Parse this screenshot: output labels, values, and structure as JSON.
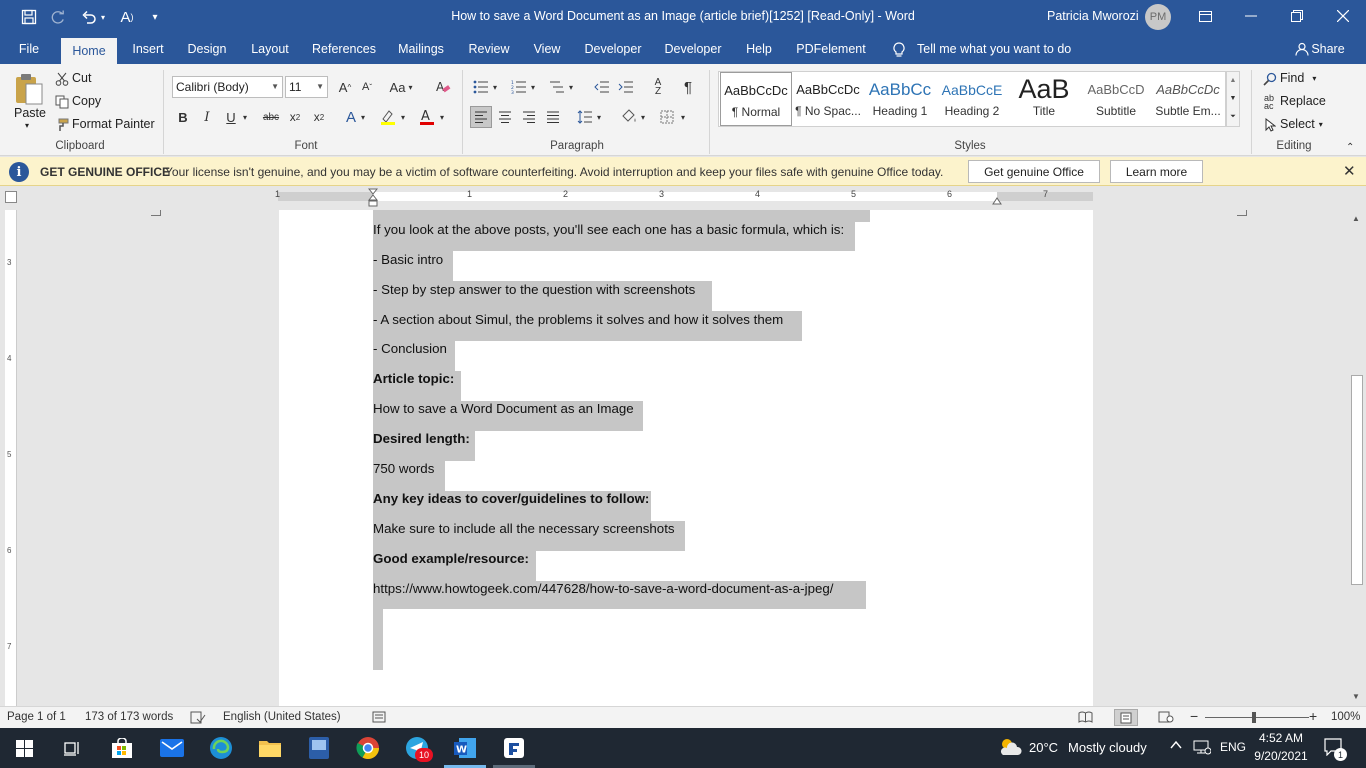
{
  "window": {
    "title": "How to save a Word Document as an Image (article brief)[1252] [Read-Only]  -  Word",
    "user_name": "Patricia Mworozi",
    "avatar_initials": "PM",
    "quick_access": [
      "save-icon",
      "redo-icon",
      "undo-icon",
      "read-aloud-icon",
      "customize-qat-icon"
    ]
  },
  "menu": {
    "tabs": [
      "File",
      "Home",
      "Insert",
      "Design",
      "Layout",
      "References",
      "Mailings",
      "Review",
      "View",
      "Developer",
      "Developer",
      "Help",
      "PDFelement"
    ],
    "active": "Home",
    "tell_me": "Tell me what you want to do",
    "share": "Share"
  },
  "ribbon": {
    "clipboard": {
      "label": "Clipboard",
      "paste": "Paste",
      "cut": "Cut",
      "copy": "Copy",
      "format_painter": "Format Painter"
    },
    "font": {
      "label": "Font",
      "family": "Calibri (Body)",
      "size": "11"
    },
    "paragraph": {
      "label": "Paragraph"
    },
    "styles": {
      "label": "Styles",
      "items": [
        {
          "preview": "AaBbCcDc",
          "name": "¶ Normal"
        },
        {
          "preview": "AaBbCcDc",
          "name": "¶ No Spac..."
        },
        {
          "preview": "AaBbCc",
          "name": "Heading 1"
        },
        {
          "preview": "AaBbCcE",
          "name": "Heading 2"
        },
        {
          "preview": "AaB",
          "name": "Title"
        },
        {
          "preview": "AaBbCcD",
          "name": "Subtitle"
        },
        {
          "preview": "AaBbCcDc",
          "name": "Subtle Em..."
        }
      ]
    },
    "editing": {
      "label": "Editing",
      "find": "Find",
      "replace": "Replace",
      "select": "Select"
    }
  },
  "banner": {
    "title": "GET GENUINE OFFICE",
    "message": "Your license isn't genuine, and you may be a victim of software counterfeiting. Avoid interruption and keep your files safe with genuine Office today.",
    "primary_button": "Get genuine Office",
    "secondary_button": "Learn more"
  },
  "ruler": {
    "numbers": [
      "1",
      "1",
      "2",
      "3",
      "4",
      "5",
      "6",
      "7"
    ],
    "vertical_numbers": [
      "3",
      "4",
      "5",
      "6",
      "7"
    ]
  },
  "document": {
    "lines": [
      {
        "text": "If you look at the above posts, you'll see each one has a basic formula, which is:",
        "bold": false
      },
      {
        "text": "- Basic intro",
        "bold": false
      },
      {
        "text": "- Step by step answer to the question with screenshots",
        "bold": false
      },
      {
        "text": "- A section about Simul, the problems it solves and how it solves them",
        "bold": false
      },
      {
        "text": "- Conclusion",
        "bold": false
      },
      {
        "text": "Article topic:",
        "bold": true
      },
      {
        "text": "How to save a Word Document as an Image",
        "bold": false
      },
      {
        "text": "Desired length:",
        "bold": true
      },
      {
        "text": "750 words",
        "bold": false
      },
      {
        "text": "Any key ideas to cover/guidelines to follow:",
        "bold": true
      },
      {
        "text": "Make sure to include all the necessary screenshots",
        "bold": false
      },
      {
        "text": "Good example/resource:",
        "bold": true
      },
      {
        "text": "https://www.howtogeek.com/447628/how-to-save-a-word-document-as-a-jpeg/",
        "bold": false
      }
    ]
  },
  "status": {
    "page": "Page 1 of 1",
    "words": "173 of 173 words",
    "language": "English (United States)",
    "zoom": "100%"
  },
  "taskbar": {
    "weather_temp": "20°C",
    "weather_text": "Mostly cloudy",
    "lang": "ENG",
    "time": "4:52 AM",
    "date": "9/20/2021",
    "notification_count": "1",
    "telegram_badge": "10"
  },
  "colors": {
    "word_blue": "#2b579a",
    "banner_bg": "#fcf3cc",
    "selection": "#c6c6c6"
  }
}
